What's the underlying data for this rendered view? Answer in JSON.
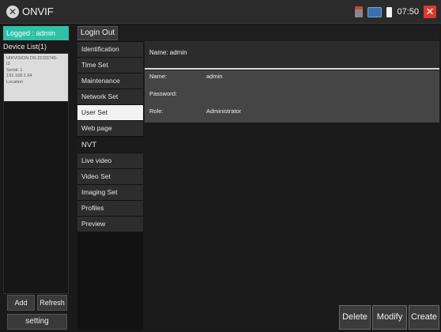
{
  "app": {
    "title": "ONVIF",
    "clock": "07:50"
  },
  "left_panel": {
    "logged_label": "Logged : admin",
    "device_list_title": "Device List(1)",
    "device": {
      "model": "HIKVISION DS-2CD3745-",
      "model_cont": "I3",
      "serial": "Serial: 1",
      "ip": "192.168.1.64",
      "location": "Location"
    },
    "add_label": "Add",
    "refresh_label": "Refresh",
    "setting_label": "setting"
  },
  "header": {
    "login_out_label": "Login Out"
  },
  "menu": {
    "items": [
      {
        "label": "Identification"
      },
      {
        "label": "Time Set"
      },
      {
        "label": "Maintenance"
      },
      {
        "label": "Network Set"
      },
      {
        "label": "User Set"
      },
      {
        "label": "Web page"
      },
      {
        "label": "NVT"
      },
      {
        "label": "Live video"
      },
      {
        "label": "Video Set"
      },
      {
        "label": "Imaging Set"
      },
      {
        "label": "Profiles"
      },
      {
        "label": "Preview"
      }
    ],
    "active": "User Set"
  },
  "content": {
    "name_header": "Name: admin",
    "fields": {
      "name_label": "Name:",
      "name_value": "admin",
      "password_label": "Password:",
      "password_value": "",
      "role_label": "Role:",
      "role_value": "Administrator"
    }
  },
  "actions": {
    "delete": "Delete",
    "modify": "Modify",
    "create": "Create"
  },
  "colors": {
    "accent": "#2fc1a8",
    "close": "#d93b2b"
  }
}
